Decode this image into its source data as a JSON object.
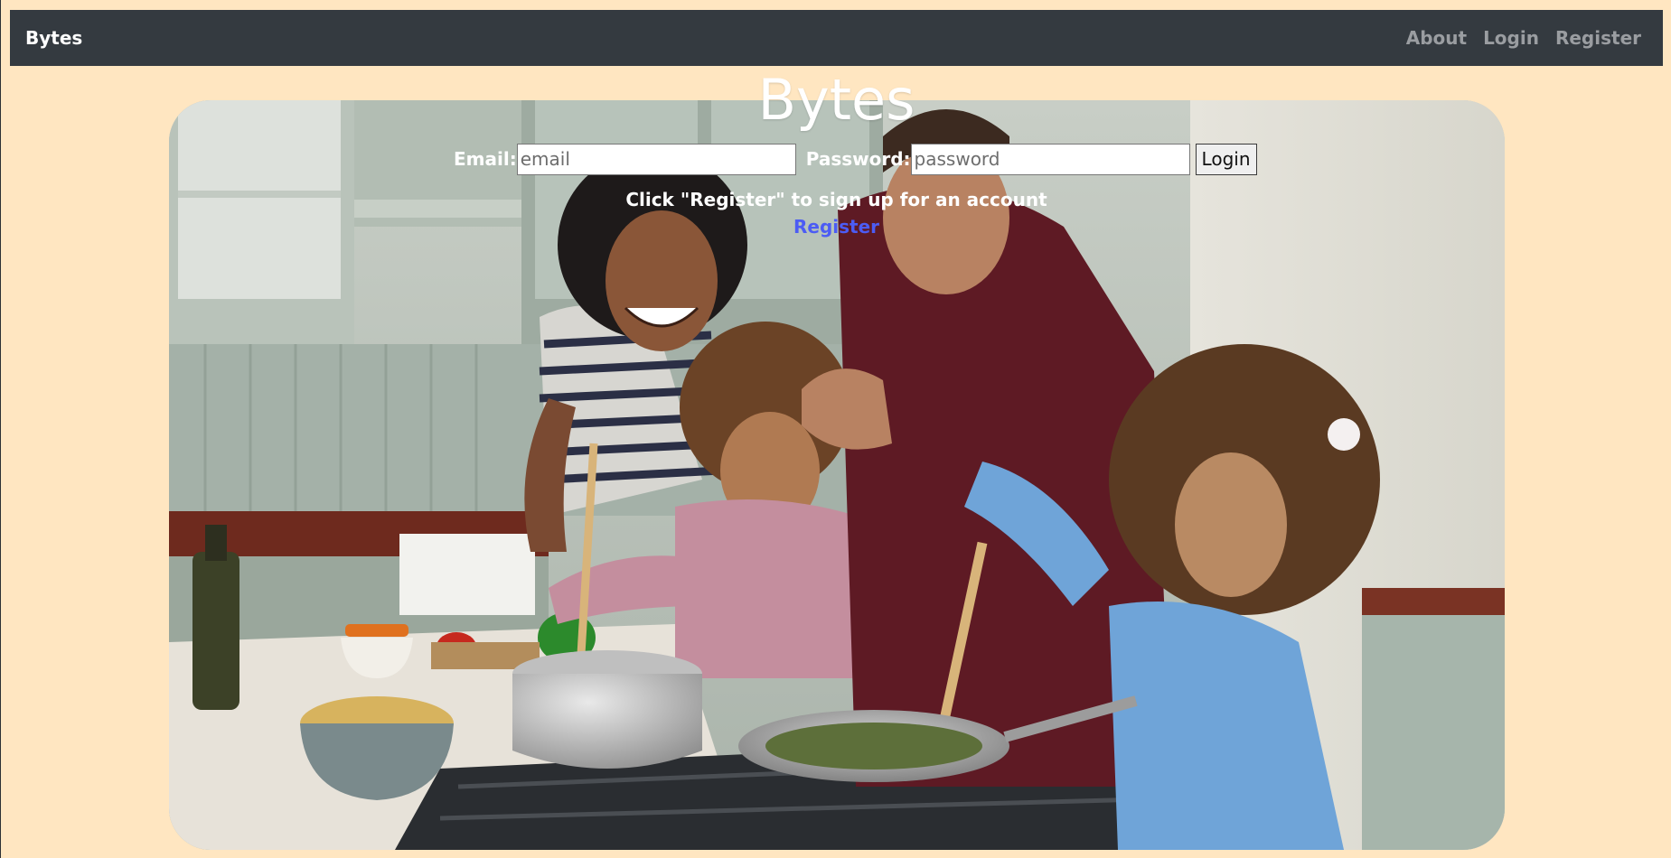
{
  "navbar": {
    "brand": "Bytes",
    "links": [
      {
        "label": "About"
      },
      {
        "label": "Login"
      },
      {
        "label": "Register"
      }
    ],
    "background": "#343a40",
    "link_color": "#9a9da1"
  },
  "page": {
    "title": "Bytes",
    "background": "#ffe6c1"
  },
  "login_form": {
    "email_label": "Email:",
    "email_placeholder": "email",
    "email_value": "",
    "password_label": "Password:",
    "password_placeholder": "password",
    "password_value": "",
    "submit_label": "Login"
  },
  "register_prompt": {
    "hint": "Click \"Register\" to sign up for an account",
    "link_label": "Register",
    "link_color": "#4c5cf4"
  },
  "hero_image": {
    "subject": "family-cooking-photo"
  }
}
